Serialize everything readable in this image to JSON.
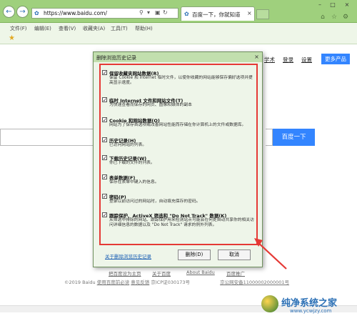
{
  "browser": {
    "address_url": "https://www.baidu.com/",
    "tab_title": "百度一下，你就知道",
    "menu": [
      "文件(F)",
      "编辑(E)",
      "查看(V)",
      "收藏夹(A)",
      "工具(T)",
      "帮助(H)"
    ]
  },
  "page": {
    "top_links": [
      "学术",
      "登录",
      "设置"
    ],
    "more_products": "更多产品",
    "search_button": "百度一下",
    "footer_links": [
      "把百度设为主页",
      "关于百度",
      "About  Baidu",
      "百度推广"
    ],
    "footer_legal": {
      "copyright": "©2019 Baidu",
      "read_before": "使用百度前必读",
      "feedback": "意见反馈",
      "icp": "京ICP证030173号",
      "police": "京公网安备11000002000001号"
    }
  },
  "dialog": {
    "title": "删除浏览历史记录",
    "options": [
      {
        "checked": true,
        "title": "保留收藏夹网站数据(R)",
        "desc": "保留 Cookie 和 Internet 临时文件，以使你收藏的网站能够保存偏好选项并提高显示速度。"
      },
      {
        "checked": true,
        "title": "临时 Internet 文件和网站文件(T)",
        "desc": "为快速查看而保存的网页、图像和媒体的副本"
      },
      {
        "checked": true,
        "title": "Cookie 和网站数据(O)",
        "desc": "网站为了保存首选项或改善网站性能而存储在你计算机上的文件或数据库。"
      },
      {
        "checked": true,
        "title": "历史记录(H)",
        "desc": "已访问网站的列表。"
      },
      {
        "checked": true,
        "title": "下载历史记录(W)",
        "desc": "你已下载的文件的列表。"
      },
      {
        "checked": true,
        "title": "表单数据(F)",
        "desc": "保存在表单中键入的信息。"
      },
      {
        "checked": true,
        "title": "密码(P)",
        "desc": "登录以前访问过的网站时，自动填充保存的密码。"
      },
      {
        "checked": true,
        "title": "跟踪保护、ActiveX 筛选和 \"Do Not Track\" 数据(K)",
        "desc": "从筛选中排除的网站、跟踪保护用来检测站点可能会在何处自动共享你的相关访问详细信息的数据以及 \"Do Not Track\" 请求的例外列表。"
      }
    ],
    "about_link": "关于删除浏览历史记录",
    "delete_button": "删除(D)",
    "cancel_button": "取消"
  },
  "watermark": {
    "text": "纯净系统之家",
    "url": "www.ycwjzy.com"
  },
  "colors": {
    "titlebar": "#9fd07d",
    "accent": "#3385ff",
    "highlight": "#e53935"
  }
}
